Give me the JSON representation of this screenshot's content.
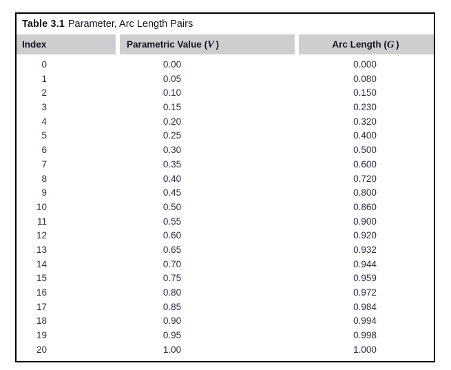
{
  "table": {
    "caption_label": "Table 3.1",
    "caption_text": "Parameter, Arc Length Pairs",
    "columns": [
      {
        "label": "Index",
        "variable": ""
      },
      {
        "label": "Parametric Value",
        "variable": "V"
      },
      {
        "label": "Arc Length",
        "variable": "G"
      }
    ],
    "header_background": "#ccced0",
    "border_color": "#000000",
    "rows": [
      {
        "index": "0",
        "parametric_value": "0.00",
        "arc_length": "0.000"
      },
      {
        "index": "1",
        "parametric_value": "0.05",
        "arc_length": "0.080"
      },
      {
        "index": "2",
        "parametric_value": "0.10",
        "arc_length": "0.150"
      },
      {
        "index": "3",
        "parametric_value": "0.15",
        "arc_length": "0.230"
      },
      {
        "index": "4",
        "parametric_value": "0.20",
        "arc_length": "0.320"
      },
      {
        "index": "5",
        "parametric_value": "0.25",
        "arc_length": "0.400"
      },
      {
        "index": "6",
        "parametric_value": "0.30",
        "arc_length": "0.500"
      },
      {
        "index": "7",
        "parametric_value": "0.35",
        "arc_length": "0.600"
      },
      {
        "index": "8",
        "parametric_value": "0.40",
        "arc_length": "0.720"
      },
      {
        "index": "9",
        "parametric_value": "0.45",
        "arc_length": "0.800"
      },
      {
        "index": "10",
        "parametric_value": "0.50",
        "arc_length": "0.860"
      },
      {
        "index": "11",
        "parametric_value": "0.55",
        "arc_length": "0.900"
      },
      {
        "index": "12",
        "parametric_value": "0.60",
        "arc_length": "0.920"
      },
      {
        "index": "13",
        "parametric_value": "0.65",
        "arc_length": "0.932"
      },
      {
        "index": "14",
        "parametric_value": "0.70",
        "arc_length": "0.944"
      },
      {
        "index": "15",
        "parametric_value": "0.75",
        "arc_length": "0.959"
      },
      {
        "index": "16",
        "parametric_value": "0.80",
        "arc_length": "0.972"
      },
      {
        "index": "17",
        "parametric_value": "0.85",
        "arc_length": "0.984"
      },
      {
        "index": "18",
        "parametric_value": "0.90",
        "arc_length": "0.994"
      },
      {
        "index": "19",
        "parametric_value": "0.95",
        "arc_length": "0.998"
      },
      {
        "index": "20",
        "parametric_value": "1.00",
        "arc_length": "1.000"
      }
    ]
  }
}
